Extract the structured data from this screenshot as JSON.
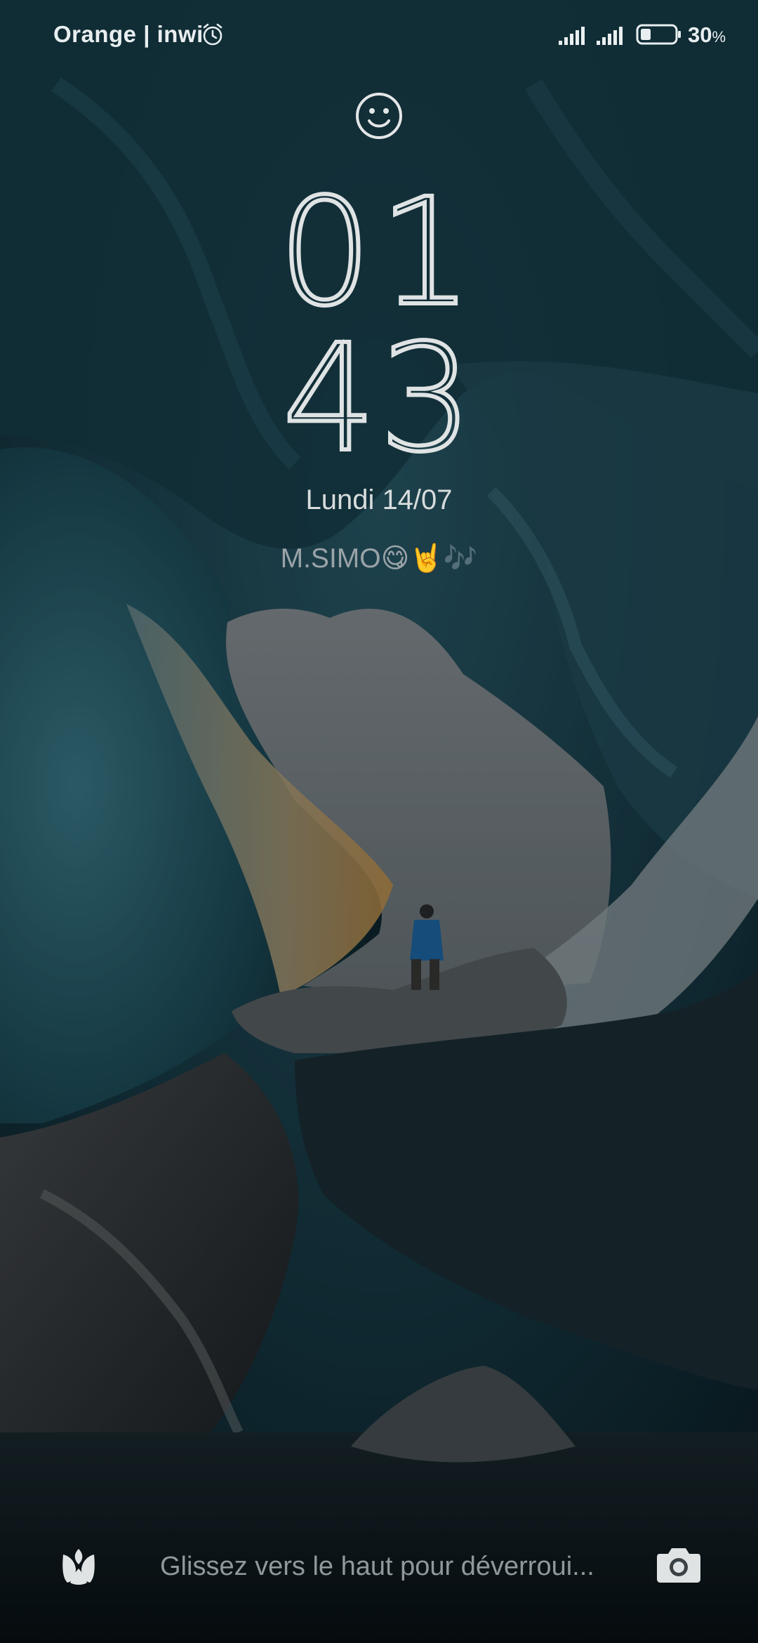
{
  "status_bar": {
    "carrier": "Orange | inwi",
    "alarm_icon": "alarm-clock-icon",
    "signal_icons": [
      "signal-sim1-icon",
      "signal-sim2-icon"
    ],
    "battery_percent": "30",
    "battery_percent_sign": "%",
    "battery_level": 0.3
  },
  "lock_screen": {
    "face_icon": "smiley-face-icon",
    "clock_hours": "01",
    "clock_minutes": "43",
    "date": "Lundi 14/07",
    "owner_info": "M.SIMO",
    "owner_emojis": "😋🤘🎶"
  },
  "bottom": {
    "left_shortcut_icon": "tulip-icon",
    "unlock_hint": "Glissez vers le haut pour déverroui...",
    "right_shortcut_icon": "camera-icon"
  },
  "colors": {
    "text_primary": "#e9eef0",
    "text_dim": "#8f989c",
    "ice_blue": "#1f4a58",
    "sky": "#a9b0b3",
    "amber": "#c89a52"
  }
}
